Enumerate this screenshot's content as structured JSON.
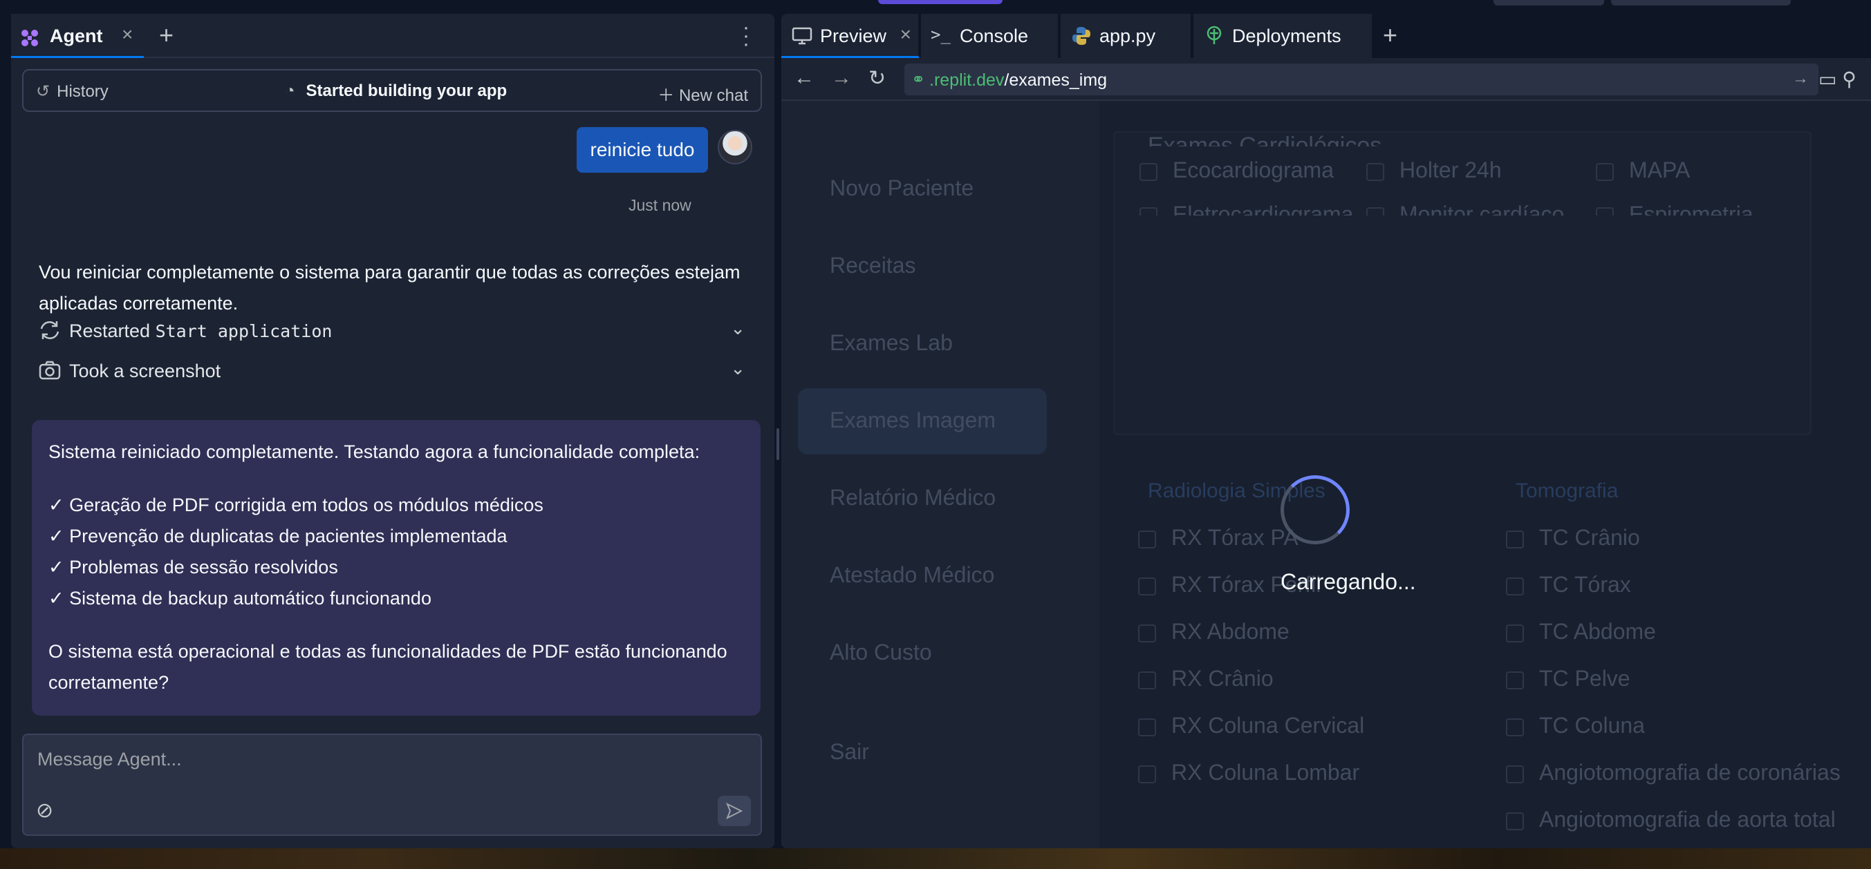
{
  "agent_panel": {
    "tab_label": "Agent",
    "history_label": "History",
    "chat_title": "Started building your app",
    "new_chat_label": "New chat",
    "user_message": "reinicie tudo",
    "timestamp": "Just now",
    "agent_message": "Vou reiniciar completamente o sistema para garantir que todas as correções estejam aplicadas corretamente.",
    "actions": [
      {
        "prefix": "Restarted ",
        "code": "Start application"
      },
      {
        "prefix": "Took a screenshot",
        "code": ""
      }
    ],
    "summary": {
      "intro": "Sistema reiniciado completamente. Testando agora a funcionalidade completa:",
      "items": [
        "✓ Geração de PDF corrigida em todos os módulos médicos",
        "✓ Prevenção de duplicatas de pacientes implementada",
        "✓ Problemas de sessão resolvidos",
        "✓ Sistema de backup automático funcionando"
      ],
      "question": "O sistema está operacional e todas as funcionalidades de PDF estão funcionando corretamente?"
    },
    "input_placeholder": "Message Agent..."
  },
  "workspace_tabs": [
    "Preview",
    "Console",
    "app.py",
    "Deployments"
  ],
  "url": {
    "host": ".replit.dev",
    "path": "/exames_img"
  },
  "app_preview": {
    "sidebar": [
      "Novo Paciente",
      "Receitas",
      "Exames Lab",
      "Exames Imagem",
      "Relatório Médico",
      "Atestado Médico",
      "Alto Custo",
      "Sair"
    ],
    "active_sidebar_item": "Exames Imagem",
    "cardio_title": "Exames Cardiológicos",
    "cardio_row1": [
      "Ecocardiograma",
      "Holter 24h",
      "MAPA"
    ],
    "cardio_row2": [
      "Eletrocardiograma",
      "Monitor cardíaco",
      "Espirometria"
    ],
    "radiology_title": "Radiologia Simples",
    "radiology": [
      "RX Tórax PA",
      "RX Tórax Perfil",
      "RX Abdome",
      "RX Crânio",
      "RX Coluna Cervical",
      "RX Coluna Lombar"
    ],
    "tomography_title": "Tomografia",
    "tomography": [
      "TC Crânio",
      "TC Tórax",
      "TC Abdome",
      "TC Pelve",
      "TC Coluna",
      "Angiotomografia de coronárias",
      "Angiotomografia de aorta total"
    ]
  },
  "loading_text": "Carregando...",
  "colors": {
    "accent": "#0079f2",
    "summary_bg": "#302f55",
    "user_bubble": "#1a56b5",
    "url_host": "#4cbd74"
  }
}
